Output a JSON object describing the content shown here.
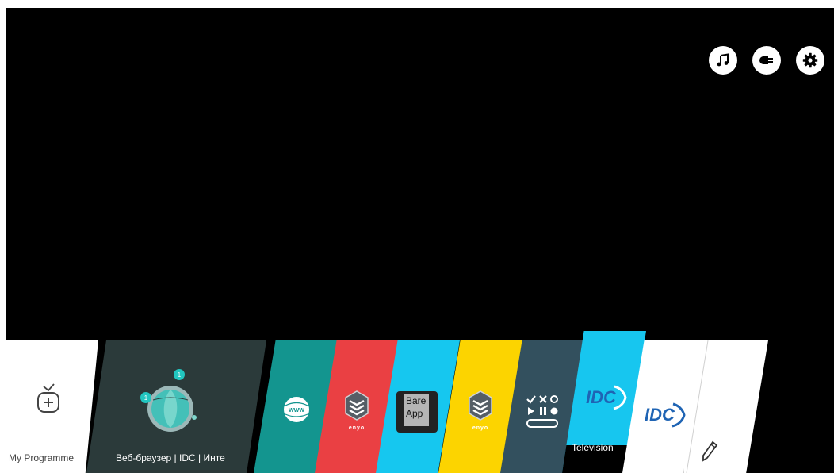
{
  "top_bar": {
    "icons": [
      "music-icon",
      "input-source-icon",
      "settings-gear-icon"
    ]
  },
  "launcher": {
    "my_programmes": {
      "label": "My Programme",
      "icon": "tv-add-icon"
    },
    "web_browser": {
      "label": "Веб-браузер | IDC | Инте",
      "notification_counts": [
        "1",
        "1"
      ]
    },
    "apps": [
      {
        "name": "web-browser-app",
        "icon": "www-globe-icon",
        "color": "#13958f"
      },
      {
        "name": "enyo-app-red",
        "icon": "enyo-icon",
        "text": "enyo",
        "color": "#ea4043"
      },
      {
        "name": "bare-app",
        "icon": "bare-app-icon",
        "text_line1": "Bare",
        "text_line2": "App",
        "color": "#16c7ef"
      },
      {
        "name": "enyo-app-yellow",
        "icon": "enyo-icon",
        "text": "enyo",
        "color": "#fcd400"
      },
      {
        "name": "remote-control-app",
        "icon": "remote-control-icon",
        "color": "#33505e"
      },
      {
        "name": "television-app",
        "icon": "idc-logo",
        "label": "Television",
        "logo_text": "IDC",
        "color": "#17c6ef"
      },
      {
        "name": "idc-app",
        "icon": "idc-logo",
        "logo_text": "IDC",
        "color": "#ffffff"
      },
      {
        "name": "edit-app",
        "icon": "pencil-icon",
        "color": "#ffffff"
      }
    ]
  },
  "colors": {
    "screen_bg": "#000000",
    "my_programmes_bg": "#ffffff",
    "web_browser_bg": "#2b3a3a",
    "idc_blue": "#1f64b4"
  }
}
